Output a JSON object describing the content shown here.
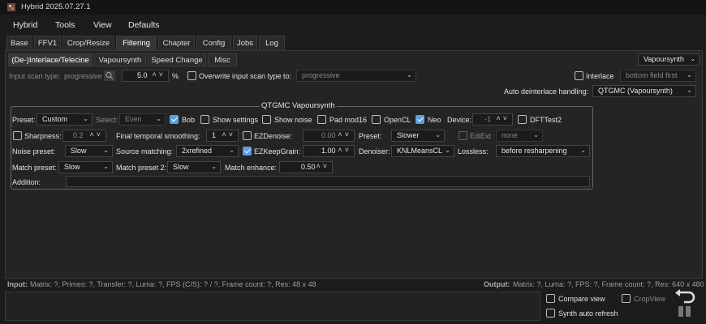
{
  "window": {
    "title": "Hybrid 2025.07.27.1"
  },
  "menu": [
    "Hybrid",
    "Tools",
    "View",
    "Defaults"
  ],
  "tabs": [
    "Base",
    "FFV1",
    "Crop/Resize",
    "Filtering",
    "Chapter",
    "Config",
    "Jobs",
    "Log"
  ],
  "active_tab": "Filtering",
  "subtabs": [
    "(De-)Interlace/Telecine",
    "Vapoursynth",
    "Speed Change",
    "Misc"
  ],
  "active_subtab": "(De-)Interlace/Telecine",
  "top_row": {
    "input_scan_type_label": "Input scan type:",
    "input_scan_type_value": "progressive",
    "percent_value": "5.0",
    "percent_unit": "%",
    "overwrite_label": "Overwrite input scan type to:",
    "overwrite_value": "progressive",
    "interlace_label": "Interlace",
    "field_order_value": "bottom field first",
    "engine_value": "Vapoursynth",
    "auto_deinterlace_label": "Auto deinterlace handling:",
    "auto_deinterlace_value": "QTGMC (Vapoursynth)"
  },
  "qtgmc": {
    "title": "QTGMC Vapoursynth",
    "row1": {
      "preset_label": "Preset:",
      "preset_value": "Custom",
      "select_label": "Select:",
      "select_value": "Even",
      "bob_label": "Bob",
      "show_settings_label": "Show settings",
      "show_noise_label": "Show noise",
      "pad_mod16_label": "Pad mod16",
      "opencl_label": "OpenCL",
      "neo_label": "Neo",
      "device_label": "Device:",
      "device_value": "-1",
      "dfttest2_label": "DFTTest2"
    },
    "row2": {
      "sharpness_label": "Sharpness:",
      "sharpness_value": "0.2",
      "fts_label": "Final temporal smoothing:",
      "fts_value": "1",
      "ezdenoise_label": "EZDenoise:",
      "ezdenoise_value": "0.00",
      "preset_label": "Preset:",
      "preset_value": "Slower",
      "ediext_label": "EdiExt",
      "ediext_value": "none"
    },
    "row3": {
      "noise_preset_label": "Noise preset:",
      "noise_preset_value": "Slow",
      "source_matching_label": "Source matching:",
      "source_matching_value": "2xrefined",
      "ezkeepgrain_label": "EZKeepGrain:",
      "ezkeepgrain_value": "1.00",
      "denoiser_label": "Denoiser:",
      "denoiser_value": "KNLMeansCL",
      "lossless_label": "Lossless:",
      "lossless_value": "before resharpening"
    },
    "row4": {
      "match_preset_label": "Match preset:",
      "match_preset_value": "Slow",
      "match_preset2_label": "Match preset 2:",
      "match_preset2_value": "Slow",
      "match_enhance_label": "Match enhance:",
      "match_enhance_value": "0.50"
    },
    "addition_label": "Addition:"
  },
  "status": {
    "input_label": "Input:",
    "input_text": "Matrix: ?, Primes: ?, Transfer: ?, Luma: ?, FPS (C/S): ? / ?, Frame count: ?, Res: 48 x 48",
    "output_label": "Output:",
    "output_text": "Matrix: ?, Luma: ?, FPS: ?, Frame count: ?, Res: 640 x 480"
  },
  "bottom": {
    "compare_view_label": "Compare view",
    "crop_view_label": "CropView",
    "synth_auto_refresh_label": "Synth auto refresh"
  }
}
